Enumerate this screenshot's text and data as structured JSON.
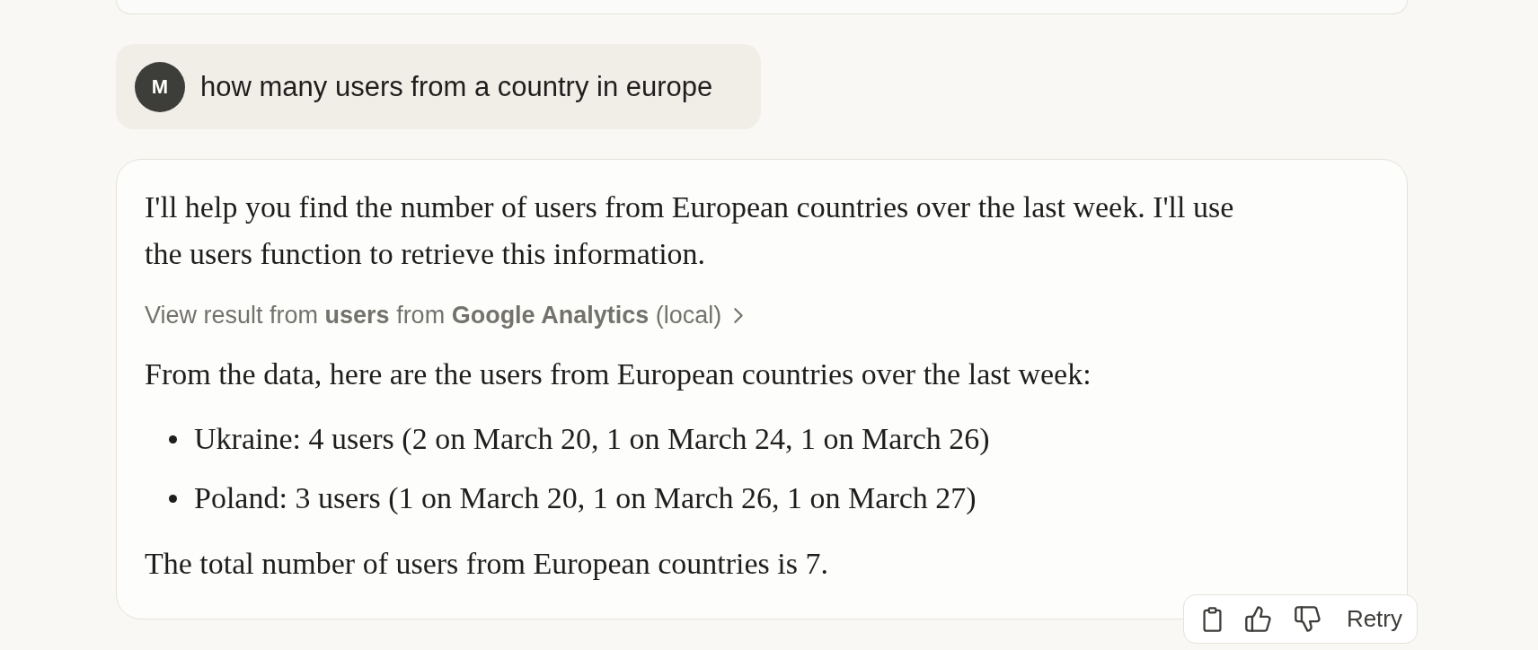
{
  "user_message": {
    "avatar_initial": "M",
    "text": "how many users from a country in europe"
  },
  "assistant_message": {
    "blocks": [
      {
        "kind": "paragraph",
        "text": "I'll help you find the number of users from European countries over the last week. I'll use the users function to retrieve this information."
      },
      {
        "kind": "tool_result",
        "text": "View result from **users** from **Google Analytics** (local)"
      },
      {
        "kind": "paragraph",
        "text": "From the data, here are the users from European countries over the last week:"
      },
      {
        "kind": "list",
        "items": [
          "Ukraine: 4 users (2 on March 20, 1 on March 24, 1 on March 26)",
          "Poland: 3 users (1 on March 20, 1 on March 26, 1 on March 27)"
        ]
      },
      {
        "kind": "paragraph",
        "text": "The total number of users from European countries is 7."
      }
    ]
  },
  "actions": [
    {
      "kind": "copy"
    },
    {
      "kind": "like"
    },
    {
      "kind": "dislike"
    },
    {
      "kind": "text",
      "label": "Retry"
    }
  ]
}
